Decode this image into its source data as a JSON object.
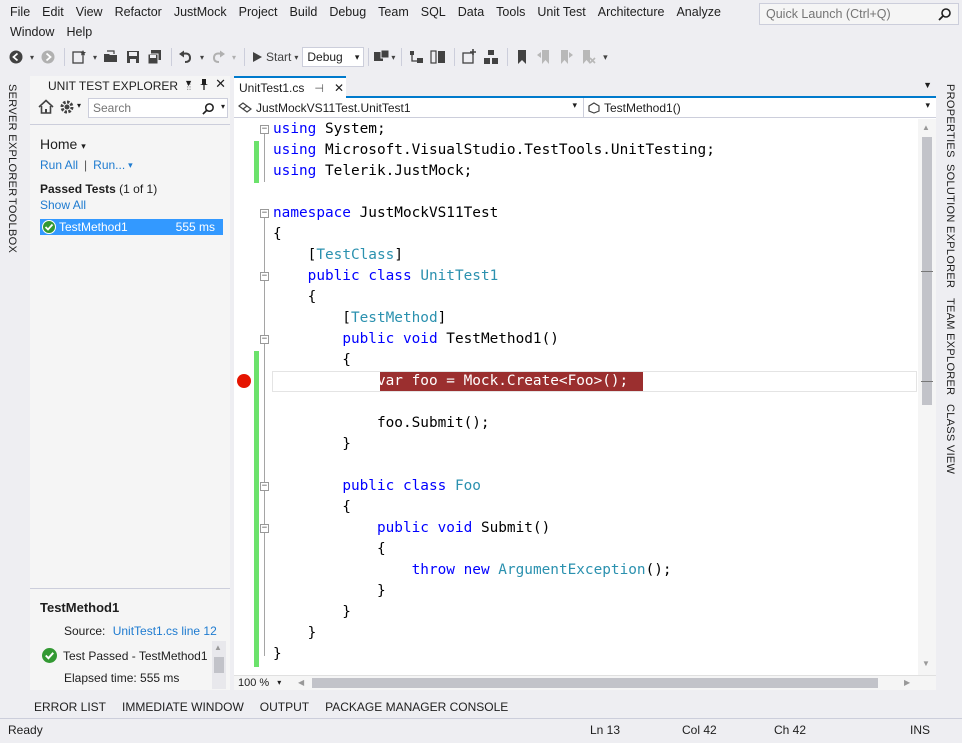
{
  "menu": {
    "row1": [
      "File",
      "Edit",
      "View",
      "Refactor",
      "JustMock",
      "Project",
      "Build",
      "Debug",
      "Team",
      "SQL",
      "Data",
      "Tools",
      "Unit Test",
      "Architecture",
      "Analyze"
    ],
    "row2": [
      "Window",
      "Help"
    ],
    "quick_launch_placeholder": "Quick Launch (Ctrl+Q)"
  },
  "toolbar": {
    "start_label": "Start",
    "config_value": "Debug"
  },
  "left_strip": {
    "server_explorer": "SERVER EXPLORER",
    "toolbox": "TOOLBOX"
  },
  "right_strip": {
    "properties": "PROPERTIES",
    "solution_explorer": "SOLUTION EXPLORER",
    "team_explorer": "TEAM EXPLORER",
    "class_view": "CLASS VIEW"
  },
  "unit_test_explorer": {
    "title": "UNIT TEST EXPLORER",
    "search_placeholder": "Search",
    "home_label": "Home",
    "run_all": "Run All",
    "run": "Run...",
    "passed_tests_label": "Passed Tests",
    "passed_tests_count": "(1 of 1)",
    "show_all": "Show All",
    "tests": [
      {
        "name": "TestMethod1",
        "duration": "555 ms",
        "status": "passed"
      }
    ],
    "detail": {
      "test_name": "TestMethod1",
      "source_label": "Source:",
      "source_link": "UnitTest1.cs line 12",
      "result": "Test Passed - TestMethod1",
      "elapsed": "Elapsed time: 555 ms"
    }
  },
  "editor": {
    "tab_name": "UnitTest1.cs",
    "nav_class": "JustMockVS11Test.UnitTest1",
    "nav_member": "TestMethod1()",
    "zoom": "100 %",
    "lines": [
      [
        {
          "t": "using",
          "c": "kw"
        },
        {
          "t": " System;",
          "c": "pl"
        }
      ],
      [
        {
          "t": "using",
          "c": "kw"
        },
        {
          "t": " Microsoft.VisualStudio.TestTools.UnitTesting;",
          "c": "pl"
        }
      ],
      [
        {
          "t": "using",
          "c": "kw"
        },
        {
          "t": " Telerik.JustMock;",
          "c": "pl"
        }
      ],
      [],
      [
        {
          "t": "namespace",
          "c": "kw"
        },
        {
          "t": " JustMockVS11Test",
          "c": "pl"
        }
      ],
      [
        {
          "t": "{",
          "c": "pl"
        }
      ],
      [
        {
          "t": "    [",
          "c": "pl"
        },
        {
          "t": "TestClass",
          "c": "ty"
        },
        {
          "t": "]",
          "c": "pl"
        }
      ],
      [
        {
          "t": "    ",
          "c": "pl"
        },
        {
          "t": "public",
          "c": "kw"
        },
        {
          "t": " ",
          "c": "pl"
        },
        {
          "t": "class",
          "c": "kw"
        },
        {
          "t": " ",
          "c": "pl"
        },
        {
          "t": "UnitTest1",
          "c": "ty"
        }
      ],
      [
        {
          "t": "    {",
          "c": "pl"
        }
      ],
      [
        {
          "t": "        [",
          "c": "pl"
        },
        {
          "t": "TestMethod",
          "c": "ty"
        },
        {
          "t": "]",
          "c": "pl"
        }
      ],
      [
        {
          "t": "        ",
          "c": "pl"
        },
        {
          "t": "public",
          "c": "kw"
        },
        {
          "t": " ",
          "c": "pl"
        },
        {
          "t": "void",
          "c": "kw"
        },
        {
          "t": " TestMethod1()",
          "c": "pl"
        }
      ],
      [
        {
          "t": "        {",
          "c": "pl"
        }
      ],
      [
        {
          "t": "            ",
          "c": "pl"
        },
        {
          "t": "var foo = Mock.Create<Foo>();",
          "c": "bp-text"
        }
      ],
      [],
      [
        {
          "t": "            foo.Submit();",
          "c": "pl"
        }
      ],
      [
        {
          "t": "        }",
          "c": "pl"
        }
      ],
      [],
      [
        {
          "t": "        ",
          "c": "pl"
        },
        {
          "t": "public",
          "c": "kw"
        },
        {
          "t": " ",
          "c": "pl"
        },
        {
          "t": "class",
          "c": "kw"
        },
        {
          "t": " ",
          "c": "pl"
        },
        {
          "t": "Foo",
          "c": "ty"
        }
      ],
      [
        {
          "t": "        {",
          "c": "pl"
        }
      ],
      [
        {
          "t": "            ",
          "c": "pl"
        },
        {
          "t": "public",
          "c": "kw"
        },
        {
          "t": " ",
          "c": "pl"
        },
        {
          "t": "void",
          "c": "kw"
        },
        {
          "t": " Submit()",
          "c": "pl"
        }
      ],
      [
        {
          "t": "            {",
          "c": "pl"
        }
      ],
      [
        {
          "t": "                ",
          "c": "pl"
        },
        {
          "t": "throw",
          "c": "kw"
        },
        {
          "t": " ",
          "c": "pl"
        },
        {
          "t": "new",
          "c": "kw"
        },
        {
          "t": " ",
          "c": "pl"
        },
        {
          "t": "ArgumentException",
          "c": "ty"
        },
        {
          "t": "();",
          "c": "pl"
        }
      ],
      [
        {
          "t": "            }",
          "c": "pl"
        }
      ],
      [
        {
          "t": "        }",
          "c": "pl"
        }
      ],
      [
        {
          "t": "    }",
          "c": "pl"
        }
      ],
      [
        {
          "t": "}",
          "c": "pl"
        }
      ]
    ]
  },
  "bottom_tabs": [
    "ERROR LIST",
    "IMMEDIATE WINDOW",
    "OUTPUT",
    "PACKAGE MANAGER CONSOLE"
  ],
  "status": {
    "state": "Ready",
    "line": "Ln 13",
    "col": "Col 42",
    "ch": "Ch 42",
    "mode": "INS"
  },
  "colors": {
    "accent": "#007acc",
    "breakpoint": "#e51400",
    "breakpoint_highlight": "#9b2f2f",
    "selection": "#3399ff",
    "passed": "#339933",
    "change_bar": "#6ce26c"
  }
}
